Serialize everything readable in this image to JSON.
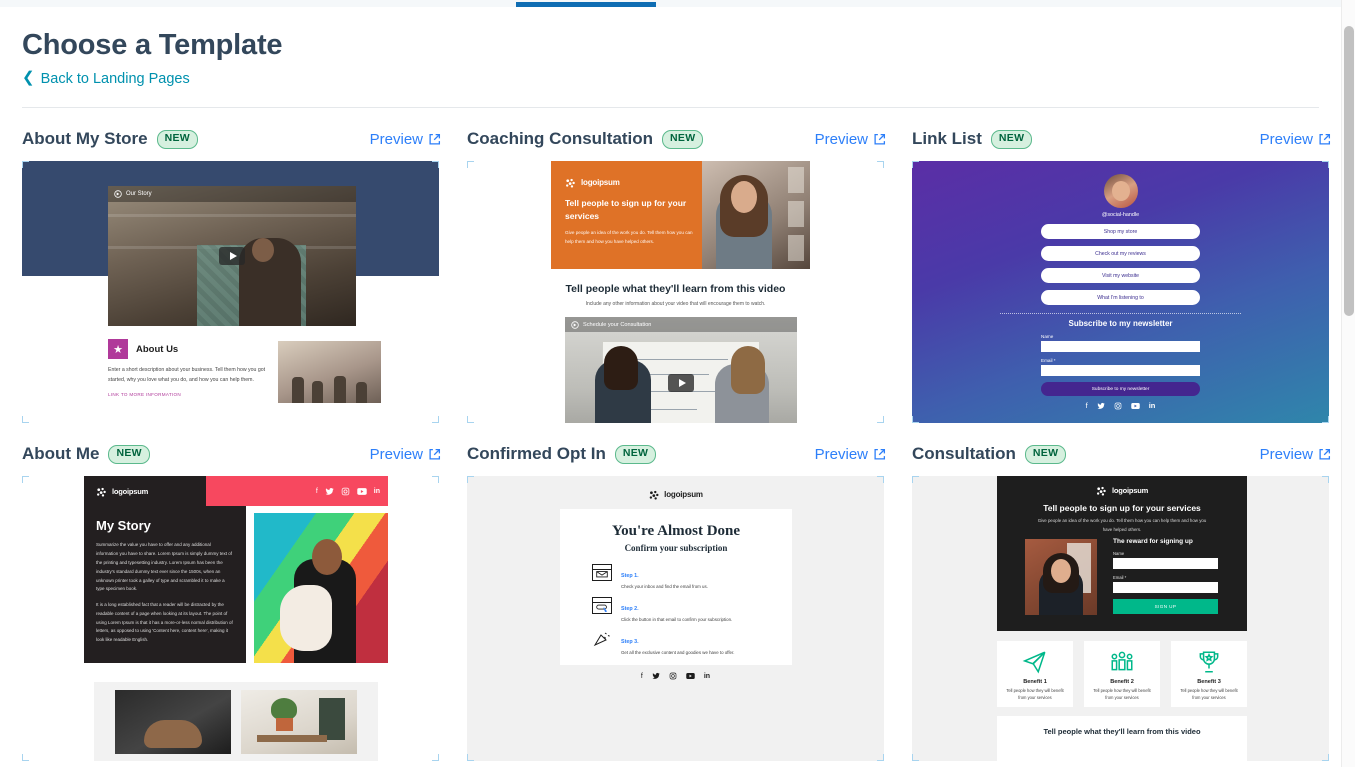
{
  "header": {
    "title": "Choose a Template",
    "back_link": "Back to Landing Pages",
    "back_chevron": "chevron-left-icon"
  },
  "templates": [
    {
      "name": "About My Store",
      "badge": "NEW",
      "preview": "Preview",
      "preview_icon": "external-link-icon",
      "preview_content": {
        "logo": "logoipsum",
        "video_label": "Our Story",
        "section_title": "About Us",
        "section_body": "Enter a short description about your business. Tell them how you got started, why you love what you do, and how you can help them.",
        "section_link": "LINK TO MORE INFORMATION"
      }
    },
    {
      "name": "Coaching Consultation",
      "badge": "NEW",
      "preview": "Preview",
      "preview_icon": "external-link-icon",
      "preview_content": {
        "logo": "logoipsum",
        "hero_title": "Tell people to sign up for your services",
        "hero_sub": "Give people an idea of the work you do. Tell them how you can help them and how you have helped others.",
        "caption_title": "Tell people what they'll learn from this video",
        "caption_sub": "Include any other information about your video that will encourage them to watch.",
        "video_label": "Schedule your Consultation"
      }
    },
    {
      "name": "Link List",
      "badge": "NEW",
      "preview": "Preview",
      "preview_icon": "external-link-icon",
      "preview_content": {
        "handle": "@social-handle",
        "links": [
          "Shop my store",
          "Check out my reviews",
          "Visit my website",
          "What I'm listening to"
        ],
        "newsletter_title": "Subscribe to my newsletter",
        "name_label": "Name",
        "name_value": "",
        "email_label": "Email *",
        "email_value": "",
        "submit_label": "Subscribe to my newsletter",
        "socials": [
          "facebook-icon",
          "twitter-icon",
          "instagram-icon",
          "youtube-icon",
          "linkedin-icon"
        ]
      }
    },
    {
      "name": "About Me",
      "badge": "NEW",
      "preview": "Preview",
      "preview_icon": "external-link-icon",
      "preview_content": {
        "logo": "logoipsum",
        "heading": "My Story",
        "paragraph1": "Summarize the value you have to offer and any additional information you have to share. Lorem Ipsum is simply dummy text of the printing and typesetting industry. Lorem Ipsum has been the industry's standard dummy text ever since the 1500s, when an unknown printer took a galley of type and scrambled it to make a type specimen book.",
        "paragraph2": "It is a long established fact that a reader will be distracted by the readable content of a page when looking at its layout. The point of using Lorem Ipsum is that it has a more-or-less normal distribution of letters, as opposed to using 'Content here, content here', making it look like readable English.",
        "socials": [
          "facebook-icon",
          "twitter-icon",
          "instagram-icon",
          "youtube-icon",
          "linkedin-icon"
        ]
      }
    },
    {
      "name": "Confirmed Opt In",
      "badge": "NEW",
      "preview": "Preview",
      "preview_icon": "external-link-icon",
      "preview_content": {
        "logo": "logoipsum",
        "title": "You're Almost Done",
        "subtitle": "Confirm your subscription",
        "steps": [
          {
            "label": "Step 1.",
            "text": "Check your inbox and find the email from us.",
            "icon": "envelope-icon"
          },
          {
            "label": "Step 2.",
            "text": "Click the button in that email to confirm your subscription.",
            "icon": "click-button-icon"
          },
          {
            "label": "Step 3.",
            "text": "Get all the exclusive content and goodies we have to offer.",
            "icon": "party-popper-icon"
          }
        ],
        "socials": [
          "facebook-icon",
          "twitter-icon",
          "instagram-icon",
          "youtube-icon",
          "linkedin-icon"
        ]
      }
    },
    {
      "name": "Consultation",
      "badge": "NEW",
      "preview": "Preview",
      "preview_icon": "external-link-icon",
      "preview_content": {
        "logo": "logoipsum",
        "hero_title": "Tell people to sign up for your services",
        "hero_sub": "Give people an idea of the work you do. Tell them how you can help them and how you have helped others.",
        "reward_title": "The reward for signing up",
        "name_label": "Name",
        "name_value": "",
        "email_label": "Email *",
        "email_value": "",
        "submit_label": "SIGN UP",
        "benefits": [
          {
            "title": "Benefit 1",
            "text": "Tell people how they will benefit from your services",
            "icon": "paper-plane-icon"
          },
          {
            "title": "Benefit 2",
            "text": "Tell people how they will benefit from your services",
            "icon": "people-icon"
          },
          {
            "title": "Benefit 3",
            "text": "Tell people how they will benefit from your services",
            "icon": "trophy-icon"
          }
        ],
        "video_caption": "Tell people what they'll learn from this video"
      }
    }
  ],
  "colors": {
    "accent_blue": "#2d7ff9",
    "link_teal": "#0091ae",
    "heading": "#33475b",
    "badge_bg": "#d6f0df",
    "badge_border": "#5bb98c",
    "badge_text": "#00643d",
    "tab_active": "#0f6db3"
  }
}
